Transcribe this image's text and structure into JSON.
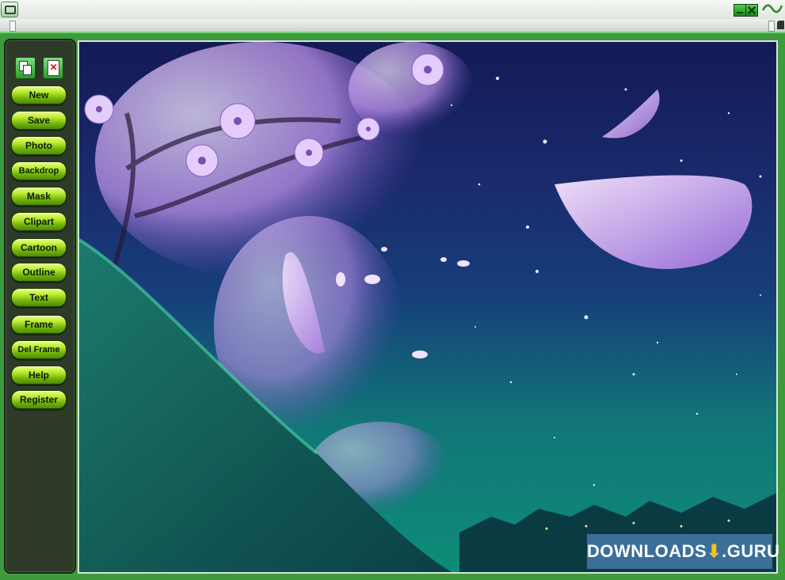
{
  "toolbar": {
    "copy_icon": "copy-icon",
    "delete_icon": "delete-icon",
    "buttons": [
      {
        "label": "New"
      },
      {
        "label": "Save"
      },
      {
        "label": "Photo"
      },
      {
        "label": "Backdrop"
      },
      {
        "label": "Mask"
      },
      {
        "label": "Clipart"
      },
      {
        "label": "Cartoon"
      },
      {
        "label": "Outline"
      },
      {
        "label": "Text"
      },
      {
        "label": "Frame"
      },
      {
        "label": "Del Frame"
      },
      {
        "label": "Help"
      },
      {
        "label": "Register"
      }
    ]
  },
  "window": {
    "accent": "#3d9a3d",
    "button_color": "#b8ea2a"
  },
  "watermark": {
    "text_left": "DOWNLOADS",
    "text_right": ".GURU",
    "background": "#3b6f9a"
  }
}
